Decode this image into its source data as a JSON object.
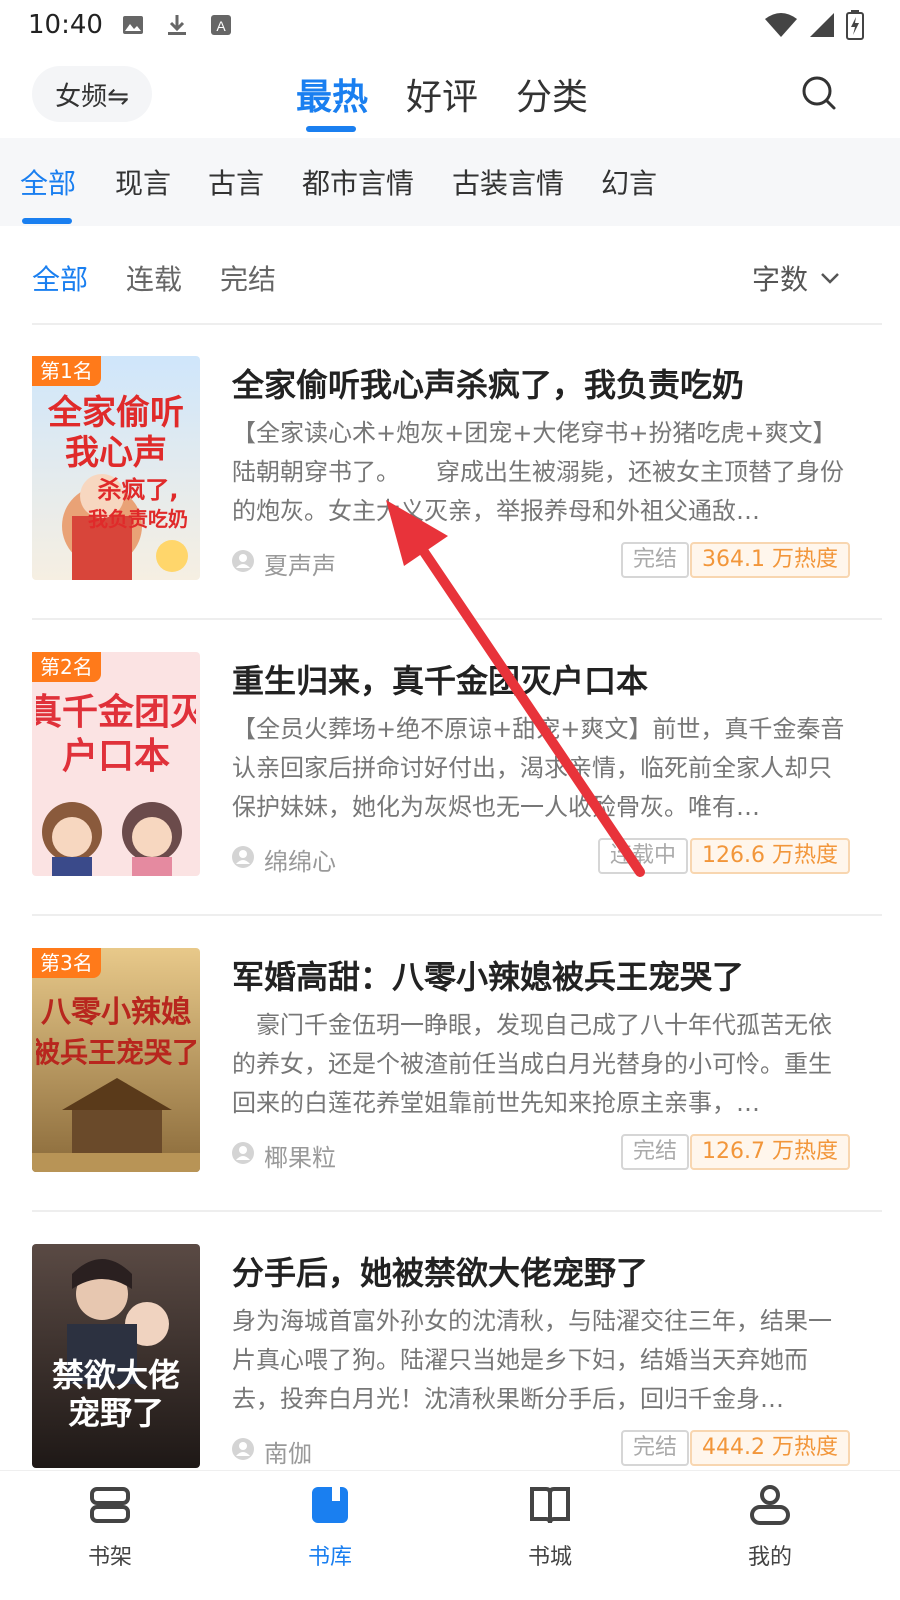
{
  "statusbar": {
    "time": "10:40"
  },
  "topnav": {
    "gender_label": "女频⇋",
    "tabs": [
      "最热",
      "好评",
      "分类"
    ]
  },
  "categories": [
    "全部",
    "现言",
    "古言",
    "都市言情",
    "古装言情",
    "幻言"
  ],
  "filters": {
    "items": [
      "全部",
      "连载",
      "完结"
    ],
    "sort_label": "字数"
  },
  "books": [
    {
      "rank": "第1名",
      "title": "全家偷听我心声杀疯了，我负责吃奶",
      "desc": "【全家读心术+炮灰+团宠+大佬穿书+扮猪吃虎+爽文】陆朝朝穿书了。　　穿成出生被溺毙，还被女主顶替了身份的炮灰。女主大义灭亲，举报养母和外祖父通敌…",
      "author": "夏声声",
      "status": "完结",
      "heat": "364.1 万热度",
      "cover_text": "全家偷听我心声杀疯了我负责吃奶"
    },
    {
      "rank": "第2名",
      "title": "重生归来，真千金团灭户口本",
      "desc": "【全员火葬场+绝不原谅+甜宠+爽文】前世，真千金秦音认亲回家后拼命讨好付出，渴求亲情，临死前全家人却只保护妹妹，她化为灰烬也无一人收殓骨灰。唯有…",
      "author": "绵绵心",
      "status": "连载中",
      "heat": "126.6 万热度",
      "cover_text": "真千金团灭户口本"
    },
    {
      "rank": "第3名",
      "title": "军婚高甜：八零小辣媳被兵王宠哭了",
      "desc": "　豪门千金伍玥一睁眼，发现自己成了八十年代孤苦无依的养女，还是个被渣前任当成白月光替身的小可怜。重生回来的白莲花养堂姐靠前世先知来抢原主亲事，…",
      "author": "椰果粒",
      "status": "完结",
      "heat": "126.7 万热度",
      "cover_text": "八零小辣媳被兵王宠哭了"
    },
    {
      "rank": "",
      "title": "分手后，她被禁欲大佬宠野了",
      "desc": "身为海城首富外孙女的沈清秋，与陆濯交往三年，结果一片真心喂了狗。陆濯只当她是乡下妇，结婚当天弃她而去，投奔白月光！沈清秋果断分手后，回归千金身…",
      "author": "南伽",
      "status": "完结",
      "heat": "444.2 万热度",
      "cover_text": "禁欲大佬宠野了"
    }
  ],
  "bottomnav": [
    "书架",
    "书库",
    "书城",
    "我的"
  ],
  "colors": {
    "accent": "#1a7ff0",
    "rank_badge": "#ff7a1a",
    "heat": "#f2963a",
    "arrow": "#e8333a"
  }
}
